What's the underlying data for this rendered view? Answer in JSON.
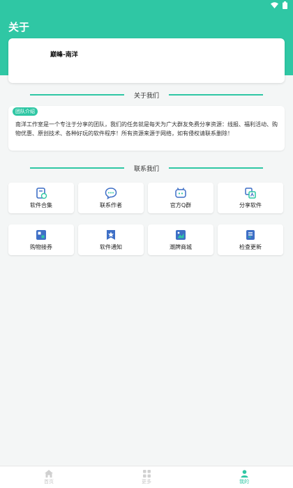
{
  "header": {
    "title": "关于"
  },
  "profile": {
    "name": "巅峰-南洋"
  },
  "about_section": {
    "title": "关于我们"
  },
  "intro": {
    "badge": "团队介绍",
    "text": "南洋工作室是一个专注于分享的团队，我们的任务就是每天为广大群友免费分享资源：线报、福利活动、购物优惠、原创技术、各种好玩的软件程序！所有资源来源于网络，如有侵权请联系删除！"
  },
  "contact_section": {
    "title": "联系我们"
  },
  "grid_row1": [
    {
      "label": "软件合集",
      "icon": "software-collection-icon"
    },
    {
      "label": "联系作者",
      "icon": "chat-icon"
    },
    {
      "label": "官方Q群",
      "icon": "qq-group-icon"
    },
    {
      "label": "分享软件",
      "icon": "share-app-icon"
    }
  ],
  "grid_row2": [
    {
      "label": "购物接券",
      "icon": "coupon-icon"
    },
    {
      "label": "软件通知",
      "icon": "notice-star-icon"
    },
    {
      "label": "潮牌商城",
      "icon": "mall-icon"
    },
    {
      "label": "检查更新",
      "icon": "update-icon"
    }
  ],
  "bottom_nav": [
    {
      "label": "首页",
      "icon": "home-icon"
    },
    {
      "label": "更多",
      "icon": "grid-icon"
    },
    {
      "label": "我的",
      "icon": "user-icon"
    }
  ],
  "colors": {
    "accent": "#2fc7a4",
    "icon_blue": "#3e6fc6"
  }
}
